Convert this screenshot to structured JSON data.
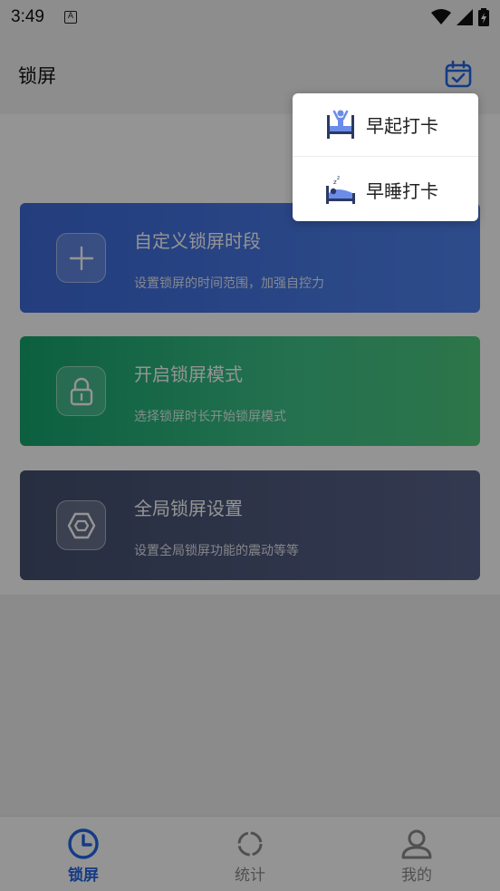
{
  "status_bar": {
    "time": "3:49",
    "notification_icon": "a-icon",
    "icons": [
      "wifi-icon",
      "signal-icon",
      "battery-charging-icon"
    ]
  },
  "app_bar": {
    "title": "锁屏",
    "calendar_icon": "calendar-check-icon"
  },
  "cards": [
    {
      "title": "自定义锁屏时段",
      "subtitle": "设置锁屏的时间范围，加强自控力",
      "icon": "plus-icon",
      "color": "#4a78e6"
    },
    {
      "title": "开启锁屏模式",
      "subtitle": "选择锁屏时长开始锁屏模式",
      "icon": "lock-icon",
      "color": "#2bb67d"
    },
    {
      "title": "全局锁屏设置",
      "subtitle": "设置全局锁屏功能的震动等等",
      "icon": "hexagon-nut-icon",
      "color": "#4e5a7d"
    }
  ],
  "popup_menu": {
    "items": [
      {
        "label": "早起打卡",
        "icon": "wake-up-icon"
      },
      {
        "label": "早睡打卡",
        "icon": "sleep-bed-icon"
      }
    ]
  },
  "bottom_nav": {
    "items": [
      {
        "label": "锁屏",
        "icon": "clock-icon",
        "active": true
      },
      {
        "label": "统计",
        "icon": "loading-circle-icon",
        "active": false
      },
      {
        "label": "我的",
        "icon": "user-icon",
        "active": false
      }
    ]
  },
  "colors": {
    "accent": "#2566e6",
    "scrim": "rgba(0,0,0,0.42)"
  }
}
